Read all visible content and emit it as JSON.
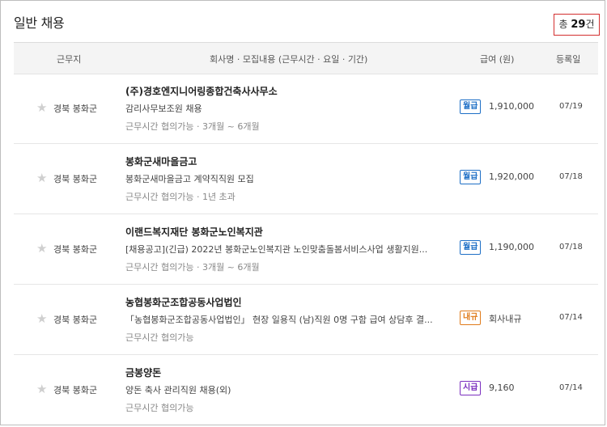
{
  "header": {
    "title": "일반 채용",
    "total_prefix": "총 ",
    "total_count": "29",
    "total_suffix": "건"
  },
  "columns": {
    "location": "근무지",
    "info": "회사명 · 모집내용 (근무시간 · 요일 · 기간)",
    "pay": "급여 (원)",
    "date": "등록일"
  },
  "rows": [
    {
      "location": "경북 봉화군",
      "company": "(주)경호엔지니어링종합건축사사무소",
      "description": "감리사무보조원 채용",
      "conditions": "근무시간 협의가능 · 3개월 ~ 6개월",
      "pay_type": "월급",
      "pay_color": "#1e6fc6",
      "pay": "1,910,000",
      "date": "07/19"
    },
    {
      "location": "경북 봉화군",
      "company": "봉화군새마을금고",
      "description": "봉화군새마을금고 계약직직원 모집",
      "conditions": "근무시간 협의가능 · 1년 초과",
      "pay_type": "월급",
      "pay_color": "#1e6fc6",
      "pay": "1,920,000",
      "date": "07/18"
    },
    {
      "location": "경북 봉화군",
      "company": "이랜드복지재단 봉화군노인복지관",
      "description": "[채용공고](긴급) 2022년 봉화군노인복지관 노인맞춤돌봄서비스사업 생활지원...",
      "conditions": "근무시간 협의가능 · 3개월 ~ 6개월",
      "pay_type": "월급",
      "pay_color": "#1e6fc6",
      "pay": "1,190,000",
      "date": "07/18"
    },
    {
      "location": "경북 봉화군",
      "company": "농협봉화군조합공동사업법인",
      "description": "「농협봉화군조합공동사업법인」 현장 일용직 (남)직원 0명 구함 급여 상담후 결...",
      "conditions": "근무시간 협의가능",
      "pay_type": "내규",
      "pay_color": "#e07b1a",
      "pay": "회사내규",
      "date": "07/14"
    },
    {
      "location": "경북 봉화군",
      "company": "금봉양돈",
      "description": "양돈 축사 관리직원 채용(외)",
      "conditions": "근무시간 협의가능",
      "pay_type": "시급",
      "pay_color": "#7b2fbf",
      "pay": "9,160",
      "date": "07/14"
    }
  ],
  "icons": {
    "favorite": "star-icon"
  }
}
